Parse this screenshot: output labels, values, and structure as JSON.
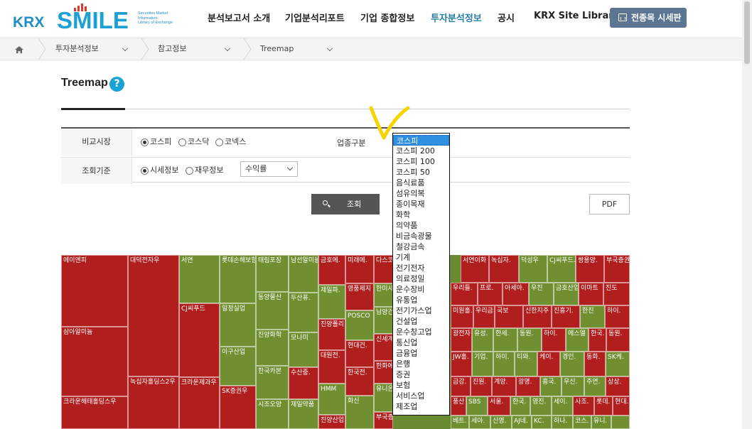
{
  "logo": {
    "primary": "KRX",
    "brand": "SMILE",
    "tagline": [
      "Securities Market",
      "Information",
      "Library of Exchange"
    ]
  },
  "nav": [
    {
      "label": "분석보고서 소개",
      "active": false
    },
    {
      "label": "기업분석리포트",
      "active": false
    },
    {
      "label": "기업 종합정보",
      "active": false
    },
    {
      "label": "투자분석정보",
      "active": true
    },
    {
      "label": "공시",
      "active": false
    },
    {
      "label": "KRX Site Library",
      "active": false
    }
  ],
  "all_stocks_button": "전종목 시세판",
  "breadcrumb": [
    "투자분석정보",
    "참고정보",
    "Treemap"
  ],
  "page_title": "Treemap",
  "help_icon_glyph": "?",
  "form": {
    "market_label": "비교시장",
    "market_options": [
      {
        "label": "코스피",
        "checked": true
      },
      {
        "label": "코스닥",
        "checked": false
      },
      {
        "label": "코넥스",
        "checked": false
      }
    ],
    "industry_label": "업종구분",
    "criteria_label": "조회기준",
    "criteria_options": [
      {
        "label": "시세정보",
        "checked": true
      },
      {
        "label": "재무정보",
        "checked": false
      }
    ],
    "metric_select_value": "수익률"
  },
  "search_button": "조회",
  "pdf_button": "PDF",
  "industry_dropdown": {
    "selected": "코스피",
    "options": [
      "코스피",
      "코스피 200",
      "코스피 100",
      "코스피 50",
      "음식료품",
      "섬유의복",
      "종이목재",
      "화학",
      "의약품",
      "비금속광물",
      "철강금속",
      "기계",
      "전기전자",
      "의료정밀",
      "운수장비",
      "유통업",
      "전기가스업",
      "건설업",
      "운수창고업",
      "통신업",
      "금융업",
      "은행",
      "증권",
      "보험",
      "서비스업",
      "제조업"
    ]
  },
  "treemap_cells": [
    "에이엔피",
    "삼아알미늄",
    "크라운해태홀딩스우",
    "대덕전자우",
    "녹십자홀딩스2우",
    "서연",
    "CJ씨푸드",
    "크라운제과우",
    "롯데손해보험",
    "일정실업",
    "이구산업",
    "SK증권우",
    "태림포장",
    "동양물산",
    "진양화학",
    "한국카본",
    "시조오양",
    "남선알미늄",
    "두산퓨.",
    "모나미",
    "수산중.",
    "제일약품",
    "금호에.",
    "제일파.",
    "진양폴리",
    "대원전.",
    "HMM",
    "진양산업",
    "미래에.",
    "영풍제지",
    "POSCO",
    "현대건.",
    "한국전.",
    "화신",
    "다스코",
    "한미사.",
    "남양건",
    "신세계",
    "한화에.",
    "유니온",
    "부국증",
    "서연이화",
    "녹십자.",
    "덕성우",
    "CJ씨푸드.",
    "쌍용양.",
    "부국증권",
    "우리들.",
    "프로.",
    "아세아.",
    "우진",
    "금호산업",
    "이마트",
    "진도",
    "미원홀.",
    "우리금.",
    "국보",
    "신한지주",
    "진흥기.",
    "한진",
    "하이.",
    "광전자",
    "유성.",
    "한세.",
    "동원.",
    "하이.",
    "에스엘",
    "한국.",
    "동원.",
    "JW홀.",
    "기업.",
    "하이.",
    "티와.",
    "케이.",
    "경인.",
    "동화.",
    "SK케.",
    "금강.",
    "진원.",
    "계양.",
    "광명.",
    "흥국.",
    "우신.",
    "주연.",
    "상상.",
    "풍산",
    "SBS",
    "서울.",
    "한국.",
    "영진.",
    "세이.",
    "사조.",
    "롯데.",
    "현대.",
    "베트.",
    "세아.",
    "신영.",
    "AJ네.",
    "KC.",
    "하나.",
    "코스.",
    "유니."
  ],
  "colors": {
    "up": "#b01e1e",
    "down": "#6f8f31",
    "accent": "#1aa3d6",
    "annotation": "#f5d400"
  }
}
